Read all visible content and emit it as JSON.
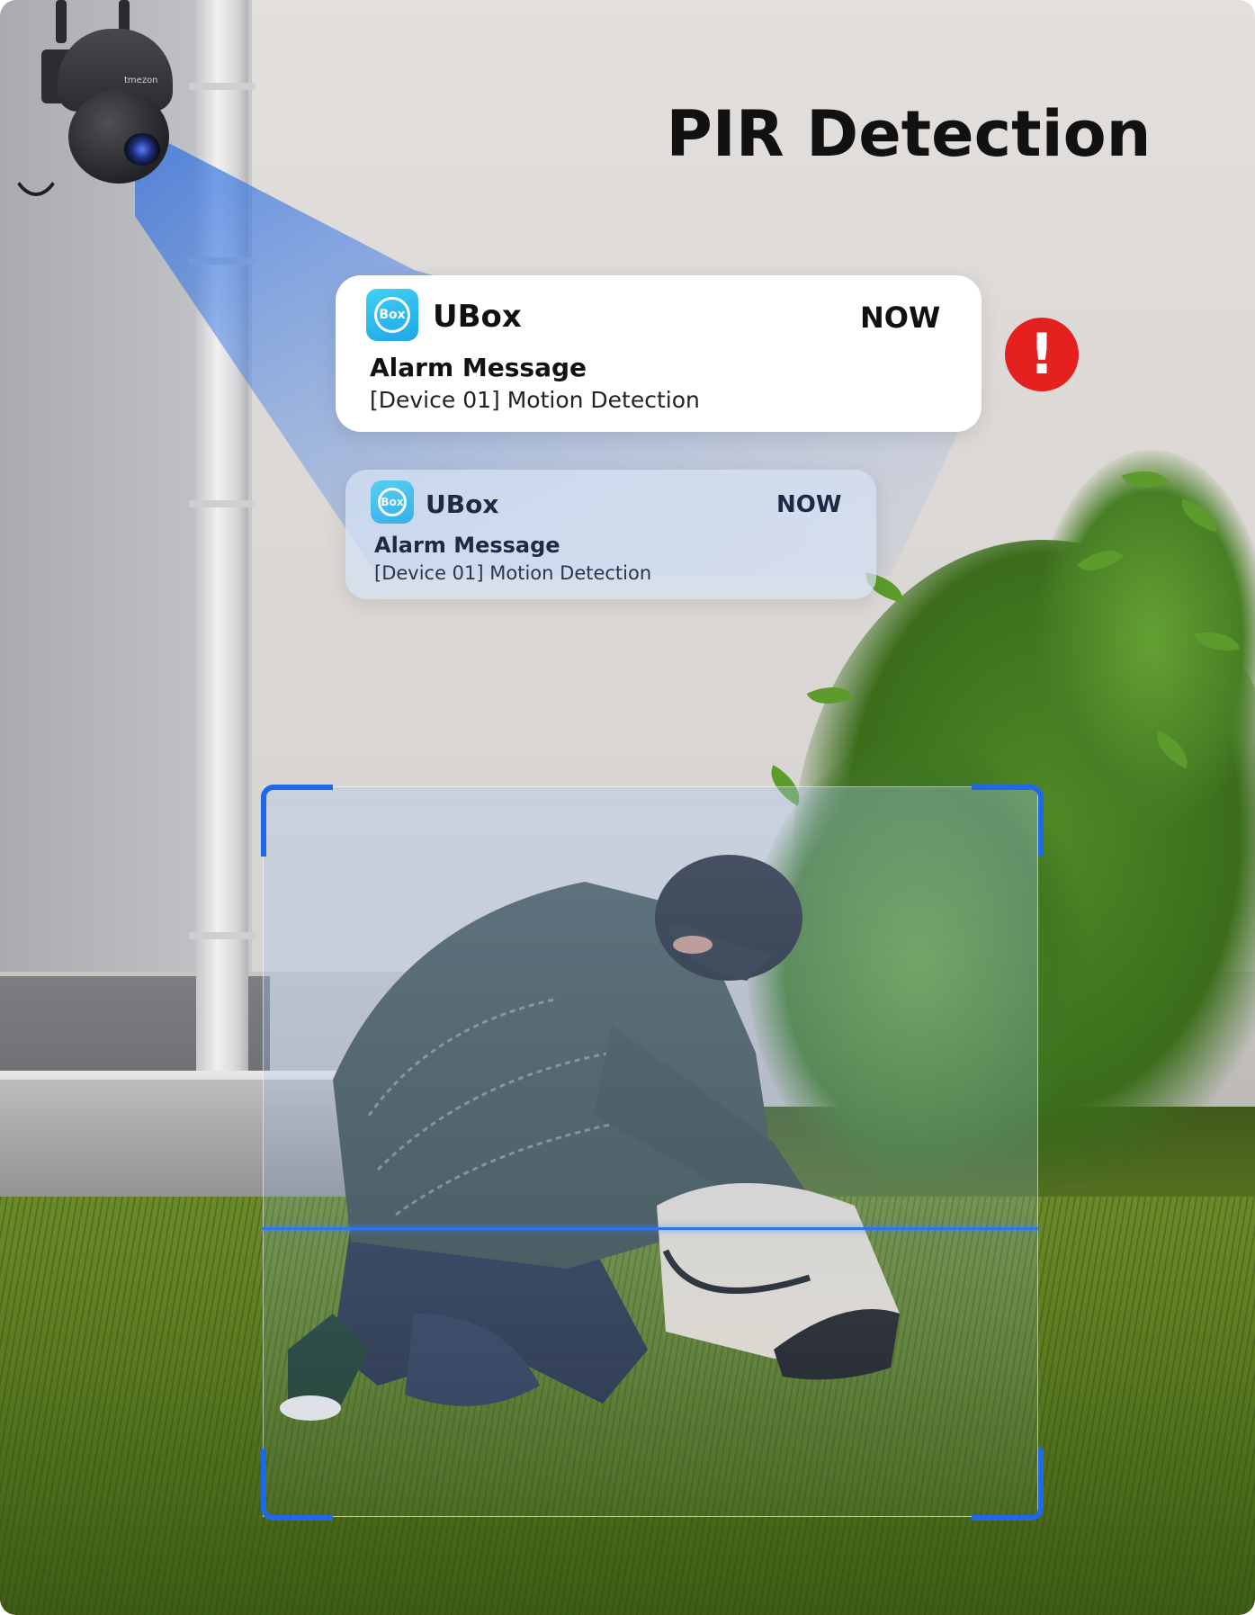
{
  "headline": "PIR Detection",
  "camera": {
    "brand_text": "tmezon",
    "icon": "security-camera-icon"
  },
  "notifications": [
    {
      "app_icon_text": "Box",
      "app_name": "UBox",
      "time": "NOW",
      "title": "Alarm Message",
      "body": "[Device 01] Motion Detection"
    },
    {
      "app_icon_text": "Box",
      "app_name": "UBox",
      "time": "NOW",
      "title": "Alarm Message",
      "body": "[Device 01] Motion Detection"
    }
  ],
  "alert_icon": {
    "symbol": "!",
    "color": "#e5211f",
    "icon": "exclamation-icon"
  },
  "colors": {
    "detection_frame": "#1f68e8",
    "app_icon": "#2ab9ee",
    "beam": "#2f6fe0"
  }
}
